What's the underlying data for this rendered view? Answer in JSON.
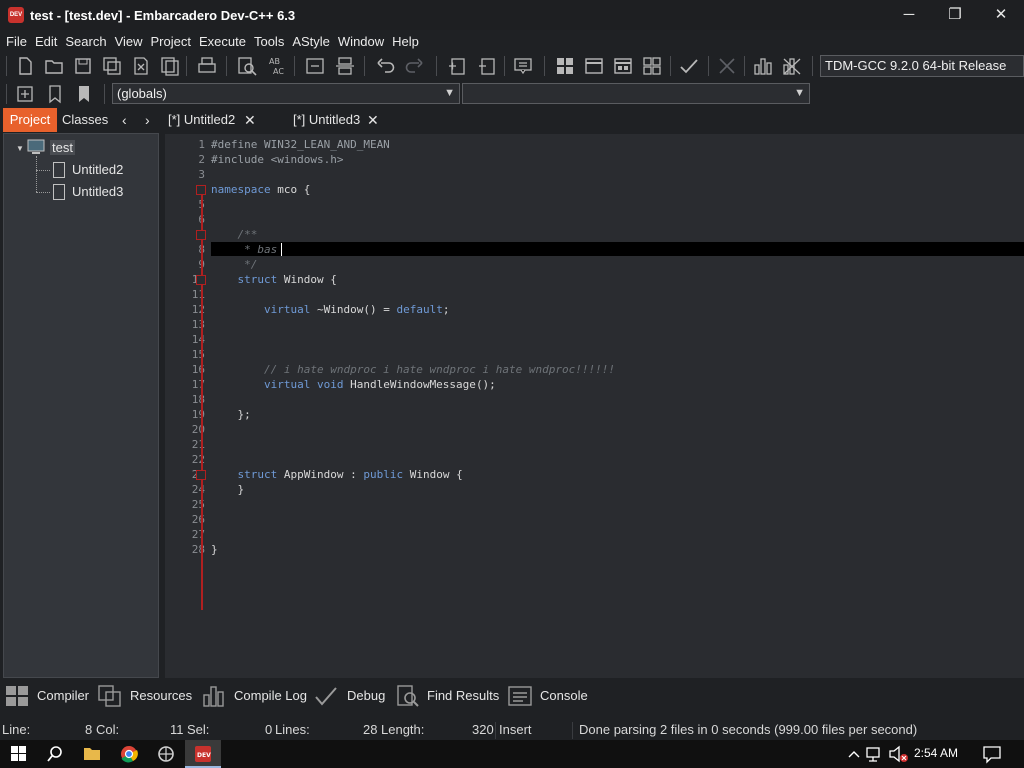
{
  "window": {
    "title": "test - [test.dev] - Embarcadero Dev-C++ 6.3",
    "app_icon_text": "DEV",
    "minimize": "─",
    "maximize": "❐",
    "close": "✕"
  },
  "menu": [
    "File",
    "Edit",
    "Search",
    "View",
    "Project",
    "Execute",
    "Tools",
    "AStyle",
    "Window",
    "Help"
  ],
  "toolbar": {
    "compiler": "TDM-GCC 9.2.0 64-bit Release",
    "scope_combo": "(globals)",
    "member_combo": ""
  },
  "left_panel": {
    "tabs": [
      "Project",
      "Classes"
    ],
    "tree": {
      "root": "test",
      "children": [
        "Untitled2",
        "Untitled3"
      ]
    }
  },
  "editor_tabs": [
    {
      "label": "[*] Untitled2",
      "active": false
    },
    {
      "label": "[*] Untitled3",
      "active": true
    }
  ],
  "code_lines": [
    "#define WIN32_LEAN_AND_MEAN",
    "#include <windows.h>",
    "",
    "namespace mco {",
    "",
    "",
    "    /**",
    "     * bas",
    "     */",
    "    struct Window {",
    "",
    "        virtual ~Window() = default;",
    "",
    "",
    "",
    "        // i hate wndproc i hate wndproc i hate wndproc!!!!!!",
    "        virtual void HandleWindowMessage();",
    "",
    "    };",
    "",
    "",
    "",
    "    struct AppWindow : public Window {",
    "    }",
    "",
    "",
    "",
    "}"
  ],
  "bottom_tabs": [
    "Compiler",
    "Resources",
    "Compile Log",
    "Debug",
    "Find Results",
    "Console"
  ],
  "status": {
    "line_label": "Line:",
    "line": "8",
    "col_label": "Col:",
    "col": "11",
    "sel_label": "Sel:",
    "sel": "0",
    "lines_label": "Lines:",
    "lines": "28",
    "length_label": "Length:",
    "length": "320",
    "mode": "Insert",
    "message": "Done parsing 2 files in 0 seconds (999.00 files per second)"
  },
  "taskbar": {
    "time": "2:54 AM"
  }
}
